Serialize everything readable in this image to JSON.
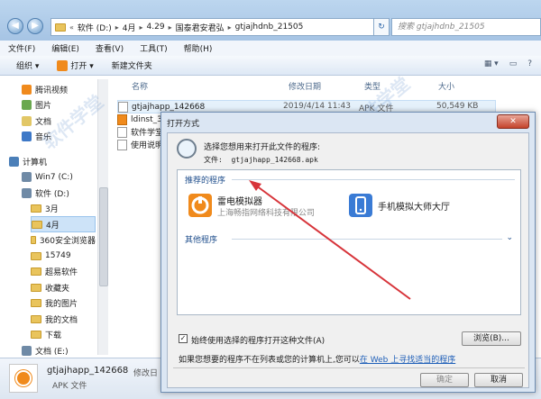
{
  "titlebar": {
    "crumbs": [
      "软件 (D:)",
      "4月",
      "4.29",
      "国泰君安君弘",
      "gtjajhdnb_21505"
    ],
    "search_placeholder": "搜索 gtjajhdnb_21505"
  },
  "menu": [
    "文件(F)",
    "编辑(E)",
    "查看(V)",
    "工具(T)",
    "帮助(H)"
  ],
  "toolbar": {
    "organize": "组织 ▾",
    "open": "打开 ▾",
    "new_folder": "新建文件夹"
  },
  "nav": [
    {
      "label": "腾讯视频",
      "kind": "video"
    },
    {
      "label": "图片",
      "kind": "pic"
    },
    {
      "label": "文档",
      "kind": "doc"
    },
    {
      "label": "音乐",
      "kind": "music"
    },
    {
      "label": "计算机",
      "kind": "pc"
    },
    {
      "label": "Win7 (C:)",
      "kind": "drive"
    },
    {
      "label": "软件 (D:)",
      "kind": "drive"
    },
    {
      "label": "3月",
      "kind": "folder"
    },
    {
      "label": "4月",
      "kind": "folder"
    },
    {
      "label": "360安全浏览器",
      "kind": "folder"
    },
    {
      "label": "15749",
      "kind": "folder"
    },
    {
      "label": "超易软件",
      "kind": "folder"
    },
    {
      "label": "收藏夹",
      "kind": "folder"
    },
    {
      "label": "我的图片",
      "kind": "folder"
    },
    {
      "label": "我的文档",
      "kind": "folder"
    },
    {
      "label": "下载",
      "kind": "folder"
    },
    {
      "label": "文档 (E:)",
      "kind": "drive"
    },
    {
      "label": "TIT-TL00",
      "kind": "phone"
    }
  ],
  "columns": {
    "name": "名称",
    "date": "修改日期",
    "type": "类型",
    "size": "大小"
  },
  "files": [
    {
      "name": "gtjajhapp_142668",
      "date": "2019/4/14 11:43",
      "type": "APK 文件",
      "size": "50,549 KB"
    },
    {
      "name": "ldinst_3.4",
      "date": "",
      "type": "",
      "size": ""
    },
    {
      "name": "软件学堂-",
      "date": "",
      "type": "",
      "size": ""
    },
    {
      "name": "使用说明",
      "date": "",
      "type": "",
      "size": ""
    }
  ],
  "status": {
    "name": "gtjajhapp_142668",
    "modified_label": "修改日",
    "type": "APK 文件"
  },
  "dialog": {
    "title": "打开方式",
    "prompt": "选择您想用来打开此文件的程序:",
    "file_label": "文件:",
    "file_name": "gtjajhapp_142668.apk",
    "recommended": "推荐的程序",
    "other": "其他程序",
    "apps": [
      {
        "name": "雷电模拟器",
        "vendor": "上海畅指网络科技有限公司"
      },
      {
        "name": "手机模拟大师大厅",
        "vendor": ""
      }
    ],
    "always_use": "始终使用选择的程序打开这种文件(A)",
    "browse": "浏览(B)...",
    "hint_prefix": "如果您想要的程序不在列表或您的计算机上,您可以",
    "hint_link": "在 Web 上寻找适当的程序",
    "ok": "确定",
    "cancel": "取消"
  },
  "colors": {
    "accent_orange": "#f08a1c",
    "arrow_red": "#d7343a",
    "link_blue": "#1f5fb8"
  }
}
